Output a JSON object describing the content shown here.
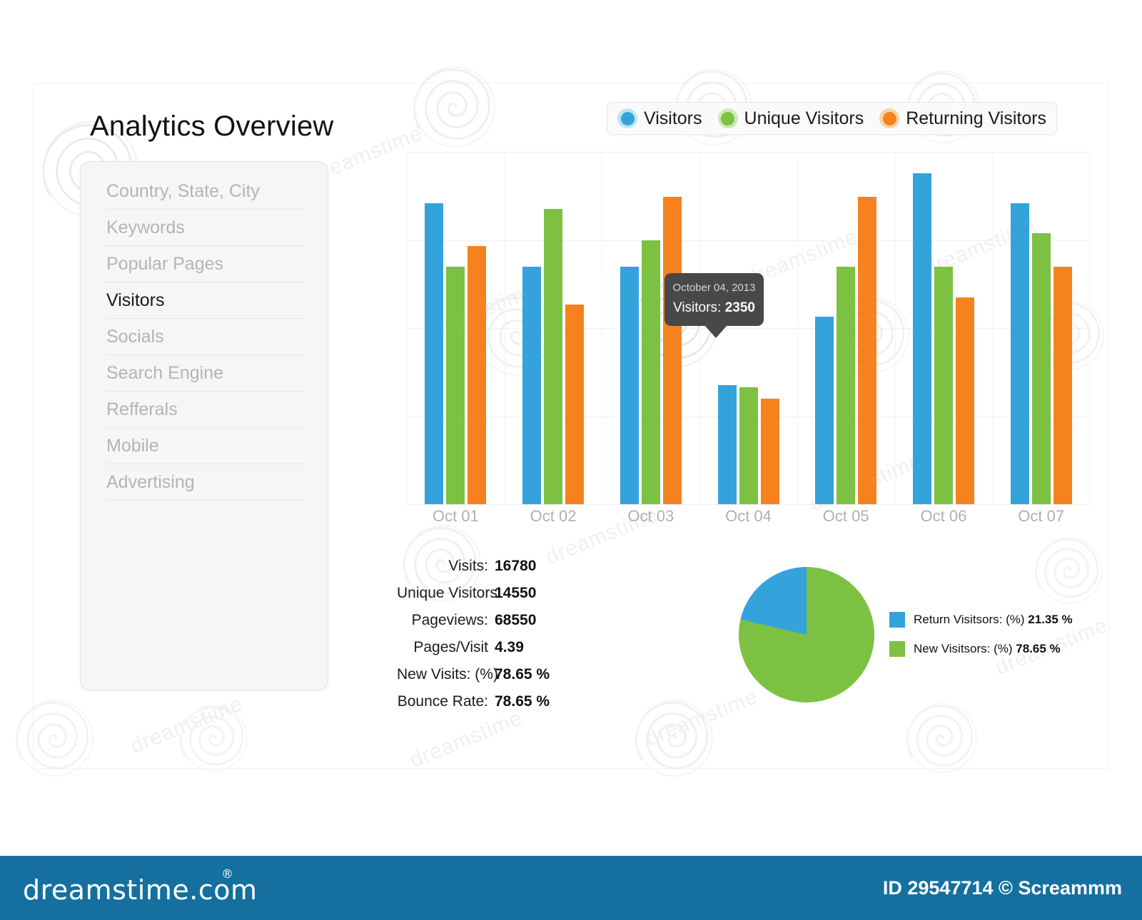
{
  "page": {
    "title": "Analytics Overview"
  },
  "sidebar": {
    "items": [
      {
        "label": "Country, State, City",
        "active": false
      },
      {
        "label": "Keywords",
        "active": false
      },
      {
        "label": "Popular Pages",
        "active": false
      },
      {
        "label": "Visitors",
        "active": true
      },
      {
        "label": "Socials",
        "active": false
      },
      {
        "label": "Search Engine",
        "active": false
      },
      {
        "label": "Refferals",
        "active": false
      },
      {
        "label": "Mobile",
        "active": false
      },
      {
        "label": "Advertising",
        "active": false
      }
    ]
  },
  "legend": {
    "items": [
      {
        "label": "Visitors",
        "color": "#34a3dc",
        "ring": "#bfe4f4"
      },
      {
        "label": "Unique Visitors",
        "color": "#7cc142",
        "ring": "#cfe9b4"
      },
      {
        "label": "Returning Visitors",
        "color": "#f6821f",
        "ring": "#fbd3a8"
      }
    ]
  },
  "tooltip": {
    "date": "October 04, 2013",
    "key": "Visitors",
    "value": "2350"
  },
  "stats": {
    "rows": [
      {
        "label": "Visits:",
        "value": "16780"
      },
      {
        "label": "Unique Visitors:",
        "value": "14550"
      },
      {
        "label": "Pageviews:",
        "value": "68550"
      },
      {
        "label": "Pages/Visit",
        "value": "4.39"
      },
      {
        "label": "New Visits: (%)",
        "value": "78.65 %"
      },
      {
        "label": "Bounce Rate:",
        "value": "78.65 %"
      }
    ]
  },
  "pie_legend": {
    "rows": [
      {
        "label": "Return Visitsors: (%)",
        "value": "21.35 %",
        "color": "#34a3dc"
      },
      {
        "label": "New Visitsors: (%)",
        "value": "78.65 %",
        "color": "#7cc142"
      }
    ]
  },
  "footer": {
    "logo": "dreamstime.com",
    "registered": "®",
    "credit": "ID 29547714 © Screammm"
  },
  "chart_data": [
    {
      "type": "bar",
      "title": "",
      "xlabel": "",
      "ylabel": "",
      "categories": [
        "Oct 01",
        "Oct 02",
        "Oct 03",
        "Oct 04",
        "Oct 05",
        "Oct 06",
        "Oct 07"
      ],
      "series": [
        {
          "name": "Visitors",
          "color": "#34a3dc",
          "values": [
            4420,
            3700,
            3700,
            2350,
            3130,
            4760,
            4420
          ]
        },
        {
          "name": "Unique Visitors",
          "color": "#7cc142",
          "values": [
            3700,
            4350,
            4000,
            2330,
            3700,
            3700,
            4080
          ]
        },
        {
          "name": "Returning Visitors",
          "color": "#f6821f",
          "values": [
            3930,
            3270,
            4490,
            2200,
            4490,
            3350,
            3700
          ]
        }
      ],
      "ylim": [
        1000,
        5000
      ],
      "yticks": [
        5000,
        4000,
        3000,
        2000,
        1000
      ],
      "grid": true,
      "legend_position": "top-right"
    },
    {
      "type": "pie",
      "title": "",
      "labels": [
        "Return Visitsors: (%)",
        "New Visitsors: (%)"
      ],
      "values": [
        21.35,
        78.65
      ],
      "colors": [
        "#34a3dc",
        "#7cc142"
      ],
      "legend_position": "right"
    }
  ]
}
